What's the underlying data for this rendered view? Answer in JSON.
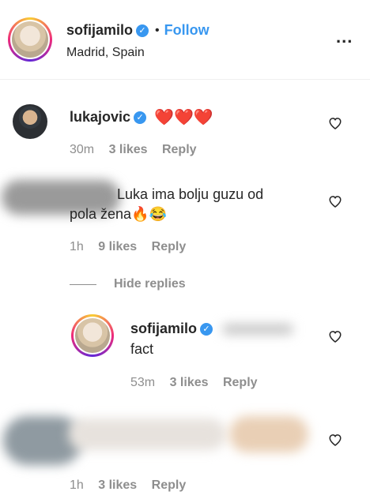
{
  "header": {
    "username": "sofijamilo",
    "dot": "•",
    "follow_label": "Follow",
    "location": "Madrid, Spain",
    "more_label": "..."
  },
  "comments": [
    {
      "username": "lukajovic",
      "text": "❤️❤️❤️",
      "time": "30m",
      "likes": "3 likes",
      "reply": "Reply"
    },
    {
      "text_line1": "Luka ima bolju guzu od",
      "text_line2": "pola žena🔥😂",
      "time": "1h",
      "likes": "9 likes",
      "reply": "Reply"
    },
    {
      "time": "1h",
      "likes": "3 likes",
      "reply": "Reply"
    }
  ],
  "replies_toggle": "Hide replies",
  "reply_comment": {
    "username": "sofijamilo",
    "text": "fact",
    "time": "53m",
    "likes": "3 likes",
    "reply": "Reply"
  },
  "colors": {
    "accent": "#3897f0",
    "text": "#262626",
    "muted": "#8e8e8e"
  }
}
